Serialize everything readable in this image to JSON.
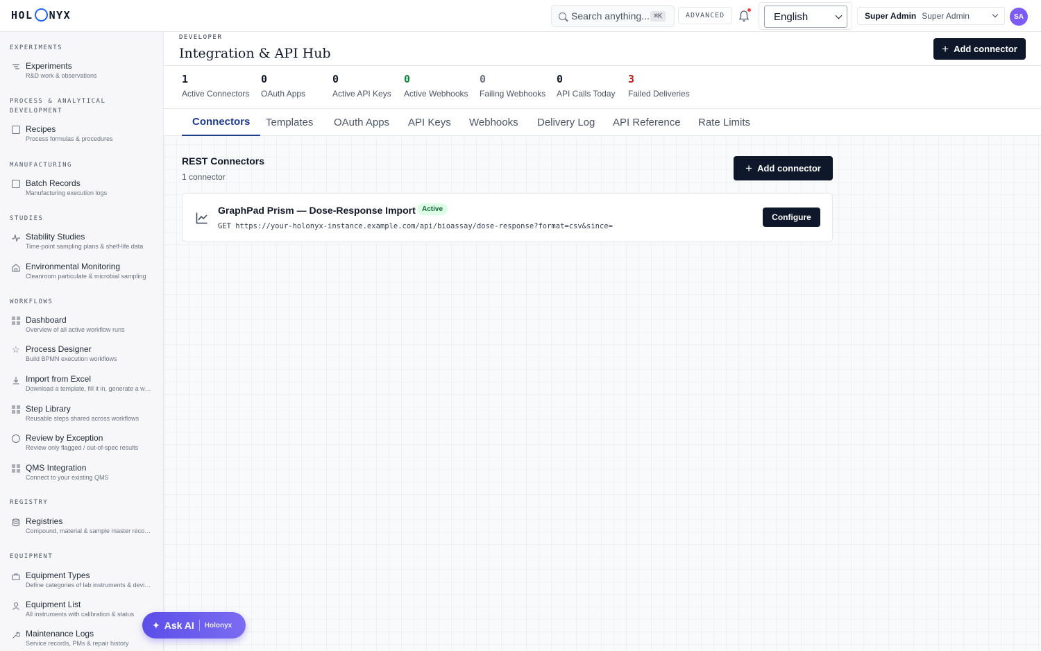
{
  "app": {
    "logo_left": "HOL",
    "logo_right": "NYX"
  },
  "topbar": {
    "search_placeholder": "Search anything...",
    "search_shortcut": "⌘K",
    "advanced_label": "ADVANCED",
    "language": "English",
    "user_role": "Super Admin",
    "user_name": "Super Admin",
    "avatar_initials": "SA"
  },
  "sidebar": {
    "sections": [
      {
        "label": "EXPERIMENTS"
      },
      {
        "label": "PROCESS & ANALYTICAL DEVELOPMENT"
      },
      {
        "label": "MANUFACTURING"
      },
      {
        "label": "STUDIES"
      },
      {
        "label": "WORKFLOWS"
      },
      {
        "label": "REGISTRY"
      },
      {
        "label": "EQUIPMENT"
      }
    ],
    "items": [
      {
        "title": "Experiments",
        "desc": "R&D work & observations",
        "icon": "flask-icon"
      },
      {
        "title": "Recipes",
        "desc": "Process formulas & procedures",
        "icon": "book-icon"
      },
      {
        "title": "Batch Records",
        "desc": "Manufacturing execution logs",
        "icon": "clipboard-icon"
      },
      {
        "title": "Stability Studies",
        "desc": "Time-point sampling plans & shelf-life data",
        "icon": "pulse-icon"
      },
      {
        "title": "Environmental Monitoring",
        "desc": "Cleanroom particulate & microbial sampling",
        "icon": "building-icon"
      },
      {
        "title": "Dashboard",
        "desc": "Overview of all active workflow runs",
        "icon": "grid-icon"
      },
      {
        "title": "Process Designer",
        "desc": "Build BPMN execution workflows",
        "icon": "star-icon"
      },
      {
        "title": "Import from Excel",
        "desc": "Download a template, fill it in, generate a workflow",
        "icon": "download-icon"
      },
      {
        "title": "Step Library",
        "desc": "Reusable steps shared across workflows",
        "icon": "grid-icon"
      },
      {
        "title": "Review by Exception",
        "desc": "Review only flagged / out-of-spec results",
        "icon": "search-icon"
      },
      {
        "title": "QMS Integration",
        "desc": "Connect to your existing QMS",
        "icon": "grid-icon"
      },
      {
        "title": "Registries",
        "desc": "Compound, material & sample master records",
        "icon": "database-icon"
      },
      {
        "title": "Equipment Types",
        "desc": "Define categories of lab instruments & devices",
        "icon": "briefcase-icon"
      },
      {
        "title": "Equipment List",
        "desc": "All instruments with calibration & status",
        "icon": "user-icon"
      },
      {
        "title": "Maintenance Logs",
        "desc": "Service records, PMs & repair history",
        "icon": "wrench-icon"
      }
    ]
  },
  "page": {
    "eyebrow": "DEVELOPER",
    "title": "Integration & API Hub",
    "add_connector_label": "Add connector"
  },
  "stats": [
    {
      "value": "1",
      "label": "Active Connectors",
      "color": "#111827"
    },
    {
      "value": "0",
      "label": "OAuth Apps",
      "color": "#111827"
    },
    {
      "value": "0",
      "label": "Active API Keys",
      "color": "#111827"
    },
    {
      "value": "0",
      "label": "Active Webhooks",
      "color": "#15803d"
    },
    {
      "value": "0",
      "label": "Failing Webhooks",
      "color": "#6b7280"
    },
    {
      "value": "0",
      "label": "API Calls Today",
      "color": "#111827"
    },
    {
      "value": "3",
      "label": "Failed Deliveries",
      "color": "#b91c1c"
    }
  ],
  "tabs": [
    {
      "label": "Connectors",
      "active": true
    },
    {
      "label": "Templates"
    },
    {
      "label": "OAuth Apps"
    },
    {
      "label": "API Keys"
    },
    {
      "label": "Webhooks"
    },
    {
      "label": "Delivery Log"
    },
    {
      "label": "API Reference"
    },
    {
      "label": "Rate Limits"
    }
  ],
  "connectors_section": {
    "title": "REST Connectors",
    "count": "1 connector",
    "add_label": "Add connector",
    "items": [
      {
        "name": "GraphPad Prism — Dose-Response Import",
        "status": "Active",
        "request": "GET https://your-holonyx-instance.example.com/api/bioassay/dose-response?format=csv&since=",
        "configure_label": "Configure"
      }
    ]
  },
  "ask_ai": {
    "label": "Ask AI",
    "brand": "Holonyx"
  }
}
